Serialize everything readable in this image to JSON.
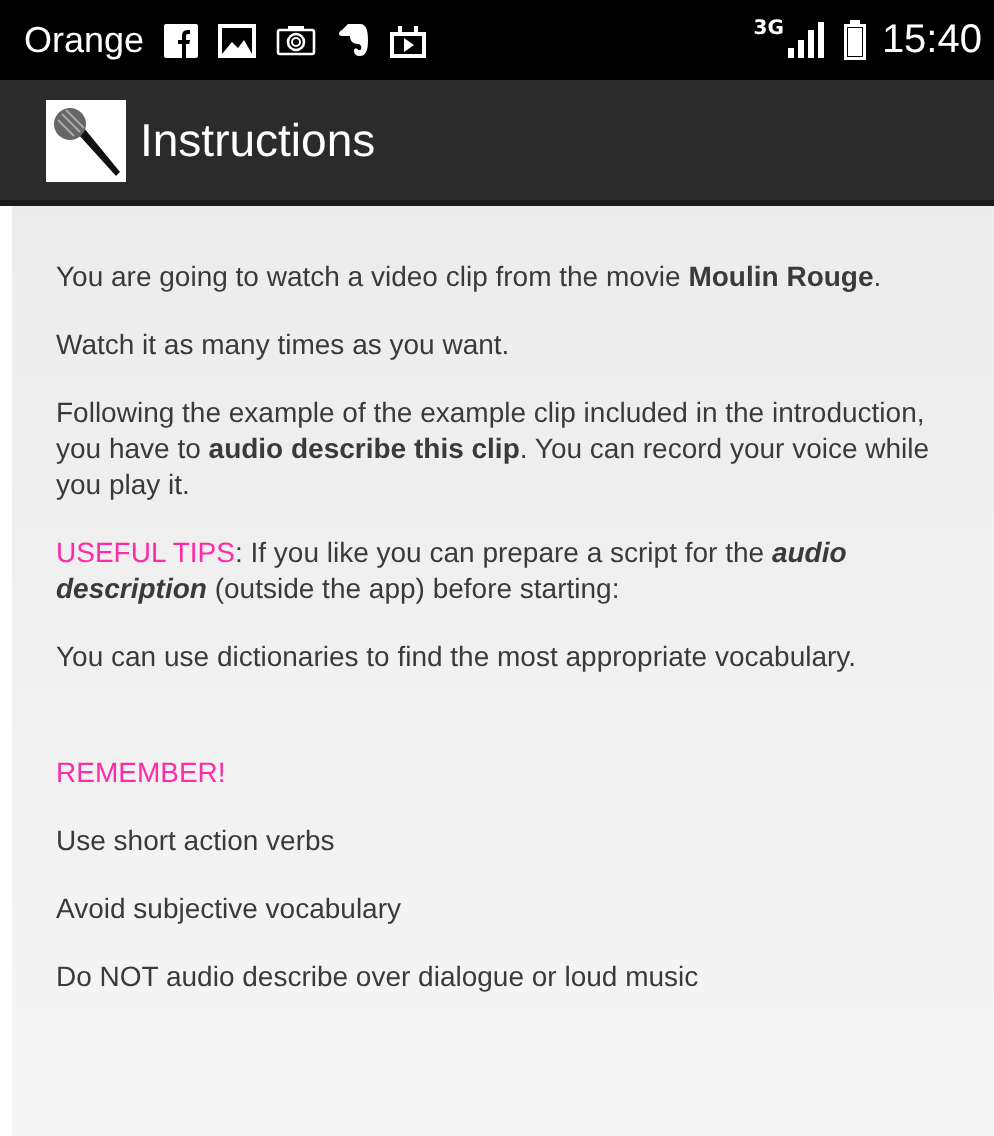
{
  "status_bar": {
    "carrier": "Orange",
    "network": "3G",
    "time": "15:40"
  },
  "action_bar": {
    "title": "Instructions"
  },
  "paragraphs": [
    {
      "kind": "text",
      "text": "You are going to watch a video clip from the movie **Moulin Rouge**."
    },
    {
      "kind": "text",
      "text": "Watch it as many times as you want."
    },
    {
      "kind": "text",
      "text": "Following the example of the example clip included in the introduction, you have to **audio describe this clip**. You can record your voice while you play it."
    },
    {
      "kind": "tip",
      "label": "USEFUL TIPS",
      "text": ": If you like you can prepare a script for the *audio description* (outside the app) before starting:"
    },
    {
      "kind": "text",
      "text": "You can use dictionaries to find the most appropriate vocabulary."
    },
    {
      "kind": "heading",
      "text": "REMEMBER!"
    },
    {
      "kind": "text",
      "text": "Use short action verbs"
    },
    {
      "kind": "text",
      "text": "Avoid subjective vocabulary"
    },
    {
      "kind": "text",
      "text": "Do NOT audio describe over dialogue or loud music"
    }
  ]
}
